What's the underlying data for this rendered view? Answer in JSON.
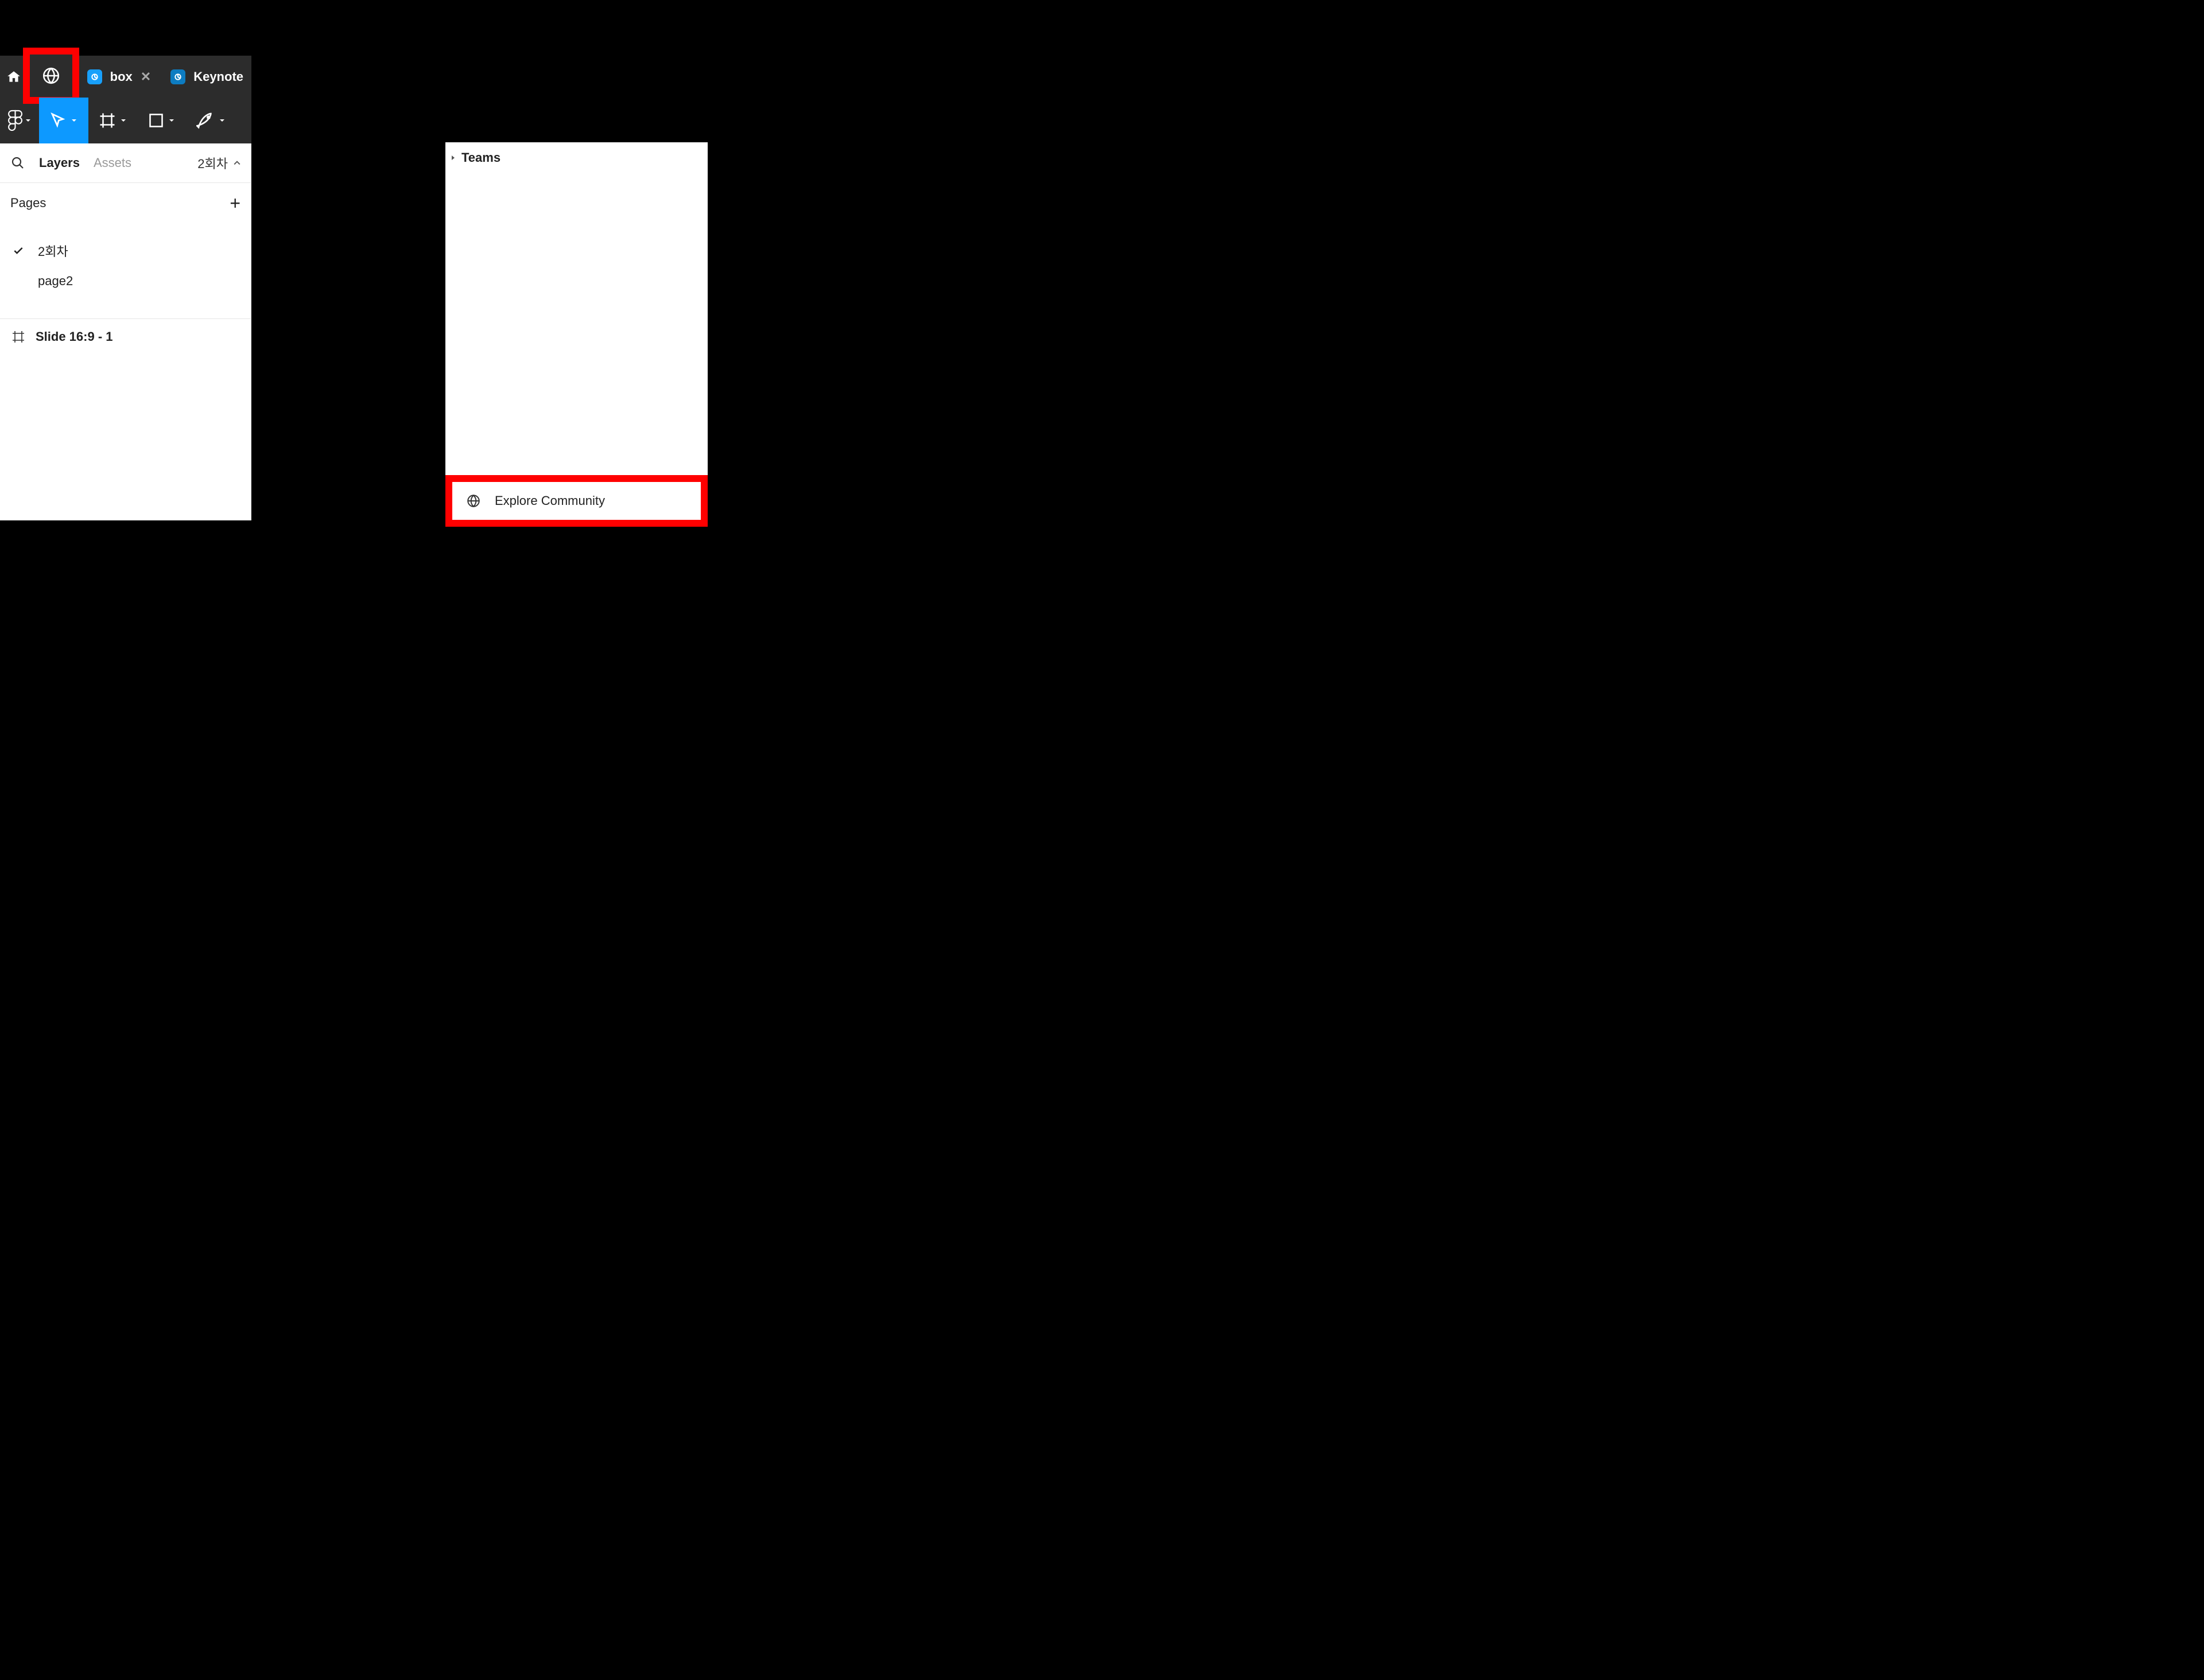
{
  "tabstrip": {
    "tab_box": "box",
    "tab_keynote": "Keynote"
  },
  "panel": {
    "layers_label": "Layers",
    "assets_label": "Assets",
    "page_selector": "2회차",
    "pages_label": "Pages",
    "pages": [
      {
        "label": "2회차",
        "selected": true
      },
      {
        "label": "page2",
        "selected": false
      }
    ],
    "layer_row": "Slide 16:9 - 1"
  },
  "right": {
    "teams_label": "Teams",
    "explore_label": "Explore Community"
  }
}
